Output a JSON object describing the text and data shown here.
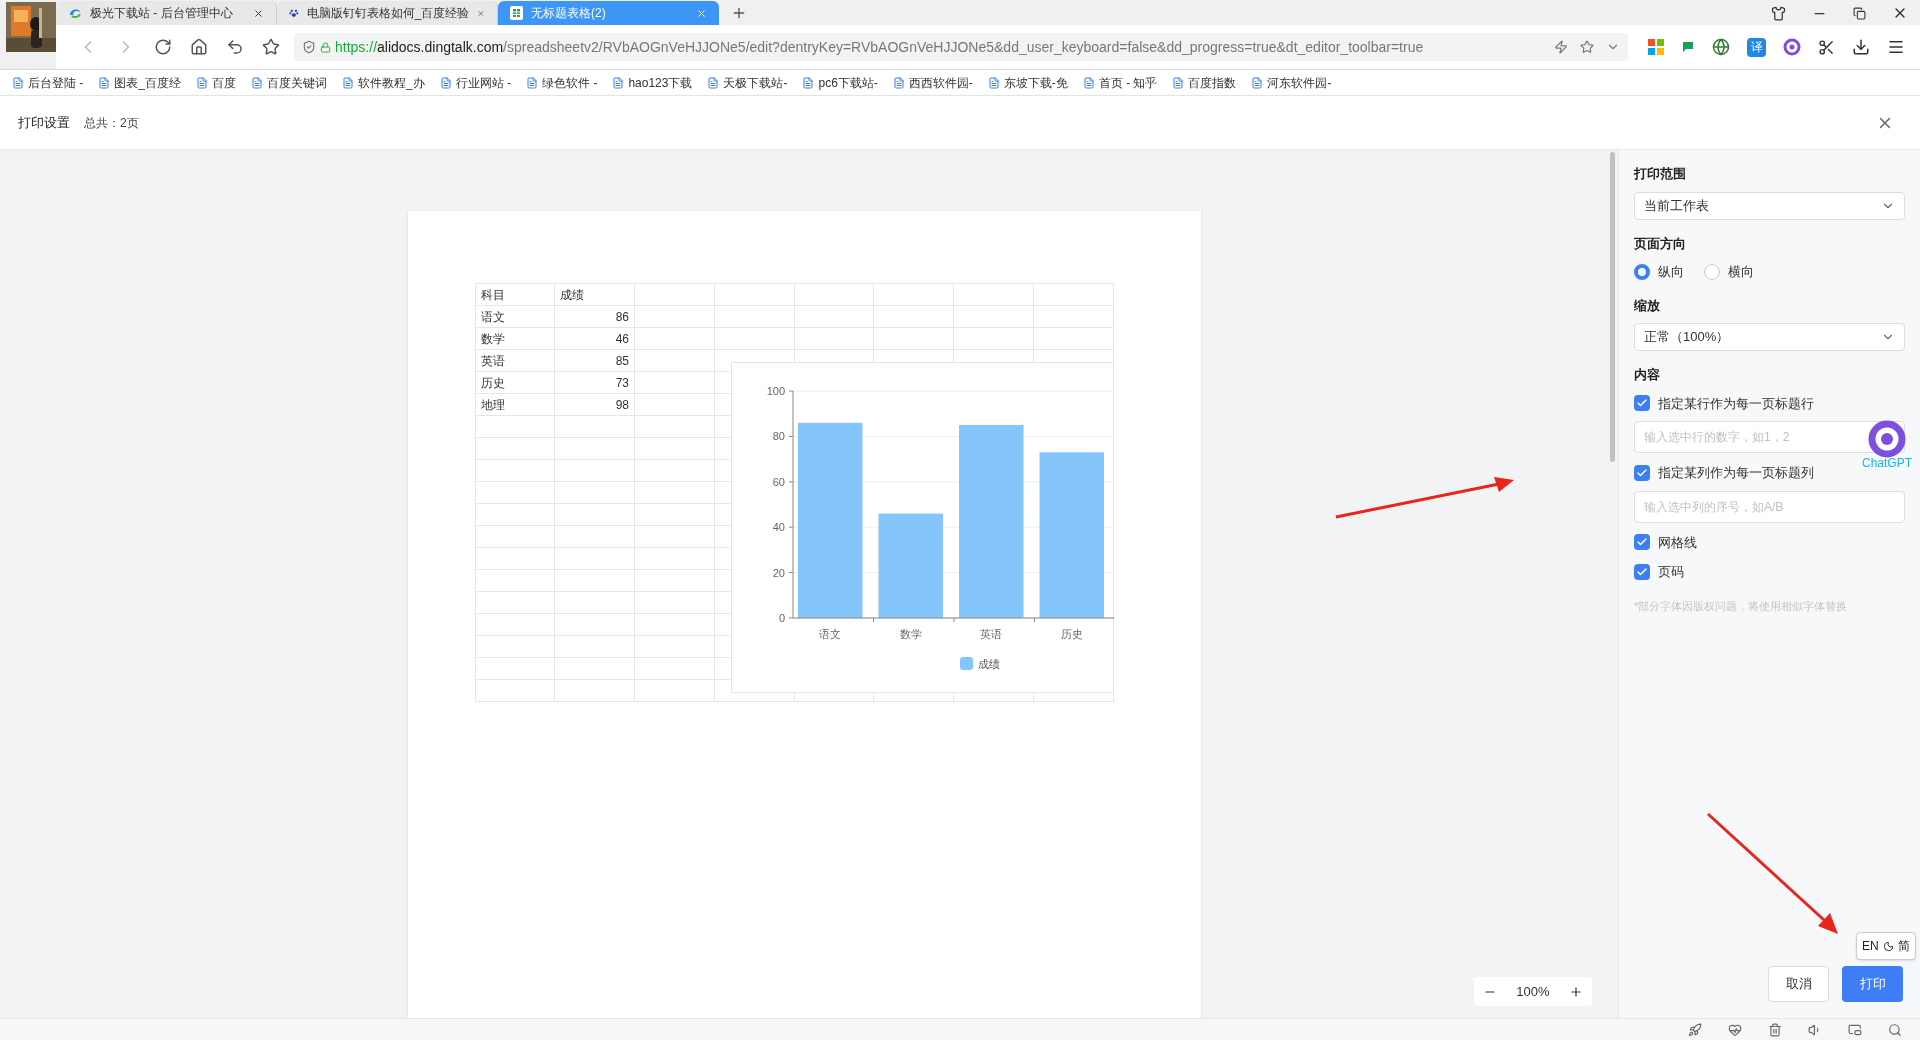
{
  "browser": {
    "tabs": [
      {
        "kind": "site",
        "label": "极光下载站 - 后台管理中心",
        "selected": false
      },
      {
        "kind": "paw",
        "label": "电脑版钉钉表格如何_百度经验",
        "selected": false
      },
      {
        "kind": "sheet",
        "label": "无标题表格(2)",
        "selected": true
      }
    ],
    "address": {
      "scheme": "https://",
      "host": "alidocs.dingtalk.com",
      "path": "/spreadsheetv2/RVbAOGnVeHJJONe5/edit?dentryKey=RVbAOGnVeHJJONe5&dd_user_keyboard=false&dd_progress=true&dt_editor_toolbar=true"
    },
    "translate_button": "译",
    "bookmarks": [
      "后台登陆 -",
      "图表_百度经",
      "百度",
      "百度关键词",
      "软件教程_办",
      "行业网站 -",
      "绿色软件 -",
      "hao123下载",
      "天极下载站-",
      "pc6下载站-",
      "西西软件园-",
      "东坡下载-免",
      "首页 - 知乎",
      "百度指数",
      "河东软件园-"
    ]
  },
  "header": {
    "title": "打印设置",
    "total": "总共：2页"
  },
  "sheet": {
    "header": [
      "科目",
      "成绩"
    ],
    "rows": [
      [
        "语文",
        "86"
      ],
      [
        "数学",
        "46"
      ],
      [
        "英语",
        "85"
      ],
      [
        "历史",
        "73"
      ],
      [
        "地理",
        "98"
      ]
    ]
  },
  "chart": {
    "chart_data": {
      "type": "bar",
      "categories": [
        "语文",
        "数学",
        "英语",
        "历史"
      ],
      "series": [
        {
          "name": "成绩",
          "color": "#84c5fb",
          "values": [
            86,
            46,
            85,
            73
          ]
        }
      ],
      "ylim": [
        0,
        100
      ],
      "yticks": [
        0,
        20,
        40,
        60,
        80,
        100
      ],
      "grid": true
    }
  },
  "zoom": {
    "value": "100%"
  },
  "panel": {
    "range_label": "打印范围",
    "range_value": "当前工作表",
    "orientation_label": "页面方向",
    "orientation_options": [
      {
        "label": "纵向",
        "selected": true
      },
      {
        "label": "横向",
        "selected": false
      }
    ],
    "scale_label": "缩放",
    "scale_value": "正常（100%）",
    "content_label": "内容",
    "content_items": [
      {
        "kind": "checkbox",
        "label": "指定某行作为每一页标题行",
        "checked": true
      },
      {
        "kind": "field",
        "placeholder": "输入选中行的数字，如1，2"
      },
      {
        "kind": "checkbox",
        "label": "指定某列作为每一页标题列",
        "checked": true
      },
      {
        "kind": "field",
        "placeholder": "输入选中列的序号，如A/B"
      },
      {
        "kind": "checkbox",
        "label": "网格线",
        "checked": true
      },
      {
        "kind": "checkbox",
        "label": "页码",
        "checked": true
      }
    ],
    "note": "*部分字体因版权问题，将使用相似字体替换",
    "buttons": [
      {
        "label": "取消",
        "primary": false
      },
      {
        "label": "打印",
        "primary": true
      }
    ]
  },
  "assistant": {
    "label": "ChatGPT"
  },
  "ime": {
    "lang": "EN",
    "mode": "简"
  }
}
